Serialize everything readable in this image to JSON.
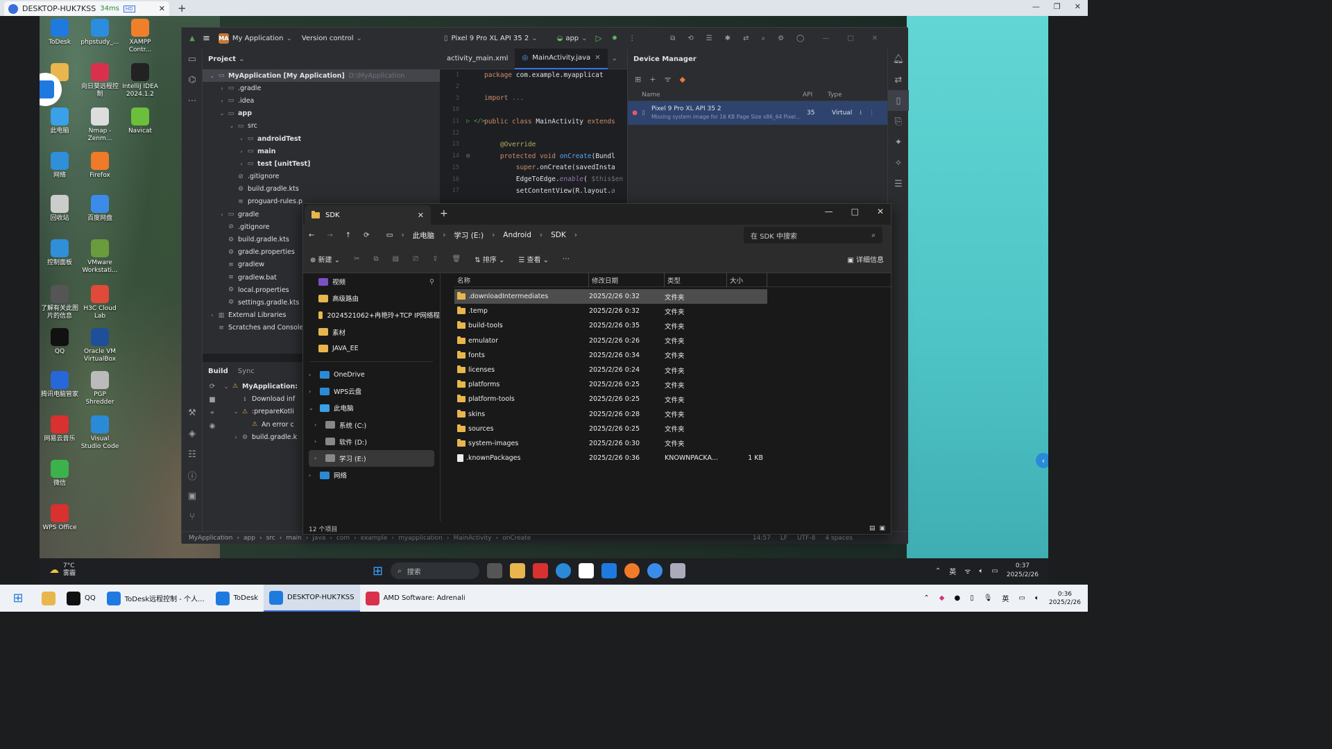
{
  "outer": {
    "tab_title": "DESKTOP-HUK7KSS",
    "latency": "34ms",
    "hd": "HD",
    "close": "✕",
    "plus": "+"
  },
  "desktop_icons": [
    {
      "label": "ToDesk",
      "color": "#1f7ae0"
    },
    {
      "label": "phpstudy_...",
      "color": "#2a8de0"
    },
    {
      "label": "XAMPP Contr...",
      "color": "#f07f2c"
    },
    {
      "label": "",
      "color": "#e8b64c"
    },
    {
      "label": "向日葵远程控制",
      "color": "#d9314b"
    },
    {
      "label": "IntelliJ IDEA 2024.1.2",
      "color": "#222"
    },
    {
      "label": "此电脑",
      "color": "#3aa0e8"
    },
    {
      "label": "Nmap - Zenm...",
      "color": "#ddd"
    },
    {
      "label": "Navicat",
      "color": "#6cbf3a"
    },
    {
      "label": "网络",
      "color": "#2f8fd8"
    },
    {
      "label": "Firefox",
      "color": "#f07a28"
    },
    {
      "label": "回收站",
      "color": "#ccc"
    },
    {
      "label": "百度网盘",
      "color": "#3b8ce8"
    },
    {
      "label": "控制面板",
      "color": "#2f8fd8"
    },
    {
      "label": "VMware Workstati...",
      "color": "#6a9b3c"
    },
    {
      "label": "了解有关此图片的信息",
      "color": "#555"
    },
    {
      "label": "H3C Cloud Lab",
      "color": "#e04a3a"
    },
    {
      "label": "QQ",
      "color": "#111"
    },
    {
      "label": "Oracle VM VirtualBox",
      "color": "#1f4f9a"
    },
    {
      "label": "腾讯电脑管家",
      "color": "#2767d9"
    },
    {
      "label": "PGP Shredder",
      "color": "#bbb"
    },
    {
      "label": "网易云音乐",
      "color": "#d93030"
    },
    {
      "label": "Visual Studio Code",
      "color": "#2b8ad8"
    },
    {
      "label": "微信",
      "color": "#3cb34a"
    },
    {
      "label": "WPS Office",
      "color": "#d93030"
    }
  ],
  "ide": {
    "project_name": "My Application",
    "vcs": "Version control",
    "device": "Pixel 9 Pro XL API 35 2",
    "run_config": "app",
    "project_pane_title": "Project",
    "tree": [
      {
        "indent": 0,
        "arrow": "v",
        "icon": "▭",
        "label": "MyApplication [My Application]",
        "dim": "D:\\MyApplication",
        "sel": true
      },
      {
        "indent": 1,
        "arrow": ">",
        "icon": "▭",
        "label": ".gradle",
        "dim": ""
      },
      {
        "indent": 1,
        "arrow": ">",
        "icon": "▭",
        "label": ".idea",
        "dim": ""
      },
      {
        "indent": 1,
        "arrow": "v",
        "icon": "▭",
        "label": "app",
        "dim": ""
      },
      {
        "indent": 2,
        "arrow": "v",
        "icon": "▭",
        "label": "src",
        "dim": ""
      },
      {
        "indent": 3,
        "arrow": ">",
        "icon": "▭",
        "label": "androidTest",
        "dim": ""
      },
      {
        "indent": 3,
        "arrow": ">",
        "icon": "▭",
        "label": "main",
        "dim": ""
      },
      {
        "indent": 3,
        "arrow": ">",
        "icon": "▭",
        "label": "test [unitTest]",
        "dim": ""
      },
      {
        "indent": 2,
        "arrow": "",
        "icon": "⊘",
        "label": ".gitignore",
        "dim": ""
      },
      {
        "indent": 2,
        "arrow": "",
        "icon": "⚙",
        "label": "build.gradle.kts",
        "dim": ""
      },
      {
        "indent": 2,
        "arrow": "",
        "icon": "≡",
        "label": "proguard-rules.p",
        "dim": ""
      },
      {
        "indent": 1,
        "arrow": ">",
        "icon": "▭",
        "label": "gradle",
        "dim": ""
      },
      {
        "indent": 1,
        "arrow": "",
        "icon": "⊘",
        "label": ".gitignore",
        "dim": ""
      },
      {
        "indent": 1,
        "arrow": "",
        "icon": "⚙",
        "label": "build.gradle.kts",
        "dim": ""
      },
      {
        "indent": 1,
        "arrow": "",
        "icon": "⚙",
        "label": "gradle.properties",
        "dim": ""
      },
      {
        "indent": 1,
        "arrow": "",
        "icon": "≡",
        "label": "gradlew",
        "dim": ""
      },
      {
        "indent": 1,
        "arrow": "",
        "icon": "≡",
        "label": "gradlew.bat",
        "dim": ""
      },
      {
        "indent": 1,
        "arrow": "",
        "icon": "⚙",
        "label": "local.properties",
        "dim": ""
      },
      {
        "indent": 1,
        "arrow": "",
        "icon": "⚙",
        "label": "settings.gradle.kts",
        "dim": ""
      },
      {
        "indent": 0,
        "arrow": ">",
        "icon": "▥",
        "label": "External Libraries",
        "dim": ""
      },
      {
        "indent": 0,
        "arrow": "",
        "icon": "≡",
        "label": "Scratches and Consoles",
        "dim": ""
      }
    ],
    "build": {
      "tab_build": "Build",
      "tab_sync": "Sync",
      "rows": [
        {
          "indent": 0,
          "arrow": "v",
          "icon": "⚠",
          "label": "MyApplication:"
        },
        {
          "indent": 1,
          "arrow": "",
          "icon": "⭳",
          "label": "Download inf"
        },
        {
          "indent": 1,
          "arrow": "v",
          "icon": "⚠",
          "label": ":prepareKotli"
        },
        {
          "indent": 2,
          "arrow": "",
          "icon": "⚠",
          "label": "An error c"
        },
        {
          "indent": 1,
          "arrow": ">",
          "icon": "⚙",
          "label": "build.gradle.k"
        }
      ]
    },
    "editor_tabs": [
      "activity_main.xml",
      "MainActivity.java"
    ],
    "code": [
      {
        "n": "1",
        "g": "",
        "html": "<span class='kw'>package</span> com.example.myapplicat"
      },
      {
        "n": "2",
        "g": "",
        "html": ""
      },
      {
        "n": "3",
        "g": "",
        "html": "<span class='kw'>import</span> <span class='cm'>...</span>"
      },
      {
        "n": "10",
        "g": "",
        "html": ""
      },
      {
        "n": "11",
        "g": "▷ </>",
        "html": "<span class='kw'>public class</span> MainActivity <span class='kw'>extends</span>"
      },
      {
        "n": "12",
        "g": "",
        "html": ""
      },
      {
        "n": "13",
        "g": "",
        "html": "&nbsp;&nbsp;&nbsp;&nbsp;<span class='an'>@Override</span>"
      },
      {
        "n": "14",
        "g": "◎",
        "html": "&nbsp;&nbsp;&nbsp;&nbsp;<span class='kw'>protected void</span> <span class='fn'>onCreate</span>(Bundl"
      },
      {
        "n": "15",
        "g": "",
        "html": "&nbsp;&nbsp;&nbsp;&nbsp;&nbsp;&nbsp;&nbsp;&nbsp;<span class='kw'>super</span>.onCreate(savedInsta"
      },
      {
        "n": "16",
        "g": "",
        "html": "&nbsp;&nbsp;&nbsp;&nbsp;&nbsp;&nbsp;&nbsp;&nbsp;EdgeToEdge.<span class='it'>enable</span>( <span class='cm'>$this$en</span>"
      },
      {
        "n": "17",
        "g": "",
        "html": "&nbsp;&nbsp;&nbsp;&nbsp;&nbsp;&nbsp;&nbsp;&nbsp;setContentView(R.layout.<span class='it'>a</span>"
      }
    ],
    "device_manager": {
      "title": "Device Manager",
      "col_name": "Name",
      "col_api": "API",
      "col_type": "Type",
      "device_name": "Pixel 9 Pro XL API 35 2",
      "device_note": "Missing system image for 16 KB Page Size x86_64 Pixel...",
      "api": "35",
      "type": "Virtual"
    },
    "status": [
      "MyApplication",
      "app",
      "src",
      "main",
      "java",
      "com",
      "example",
      "myapplication",
      "MainActivity",
      "onCreate"
    ],
    "status_right": [
      "14:57",
      "LF",
      "UTF-8",
      "4 spaces"
    ]
  },
  "explorer": {
    "tab": "SDK",
    "search_placeholder": "在 SDK 中搜索",
    "path": [
      "此电脑",
      "学习 (E:)",
      "Android",
      "SDK"
    ],
    "cmd": {
      "new": "新建",
      "sort": "排序",
      "view": "查看",
      "details": "详细信息"
    },
    "sidebar": [
      {
        "arrow": "",
        "label": "视频",
        "icon": "#7b4fc8",
        "pin": "📌"
      },
      {
        "arrow": "",
        "label": "高级路由",
        "icon": "#e8b64c"
      },
      {
        "arrow": "",
        "label": "2024521062+冉艳玲+TCP IP网络程",
        "icon": "#e8b64c"
      },
      {
        "arrow": "",
        "label": "素材",
        "icon": "#e8b64c"
      },
      {
        "arrow": "",
        "label": "JAVA_EE",
        "icon": "#e8b64c"
      },
      {
        "arrow": ">",
        "label": "OneDrive",
        "icon": "#2b8ad8"
      },
      {
        "arrow": ">",
        "label": "WPS云盘",
        "icon": "#2b8ad8"
      },
      {
        "arrow": "v",
        "label": "此电脑",
        "icon": "#3aa0e8"
      },
      {
        "arrow": ">",
        "label": "系统 (C:)",
        "icon": "#888",
        "sub": true
      },
      {
        "arrow": ">",
        "label": "软件 (D:)",
        "icon": "#888",
        "sub": true
      },
      {
        "arrow": ">",
        "label": "学习 (E:)",
        "icon": "#888",
        "sub": true,
        "sel": true
      },
      {
        "arrow": ">",
        "label": "网络",
        "icon": "#2b8ad8"
      }
    ],
    "columns": {
      "name": "名称",
      "date": "修改日期",
      "type": "类型",
      "size": "大小"
    },
    "files": [
      {
        "name": ".downloadIntermediates",
        "date": "2025/2/26 0:32",
        "type": "文件夹",
        "size": "",
        "folder": true
      },
      {
        "name": ".temp",
        "date": "2025/2/26 0:32",
        "type": "文件夹",
        "size": "",
        "folder": true
      },
      {
        "name": "build-tools",
        "date": "2025/2/26 0:35",
        "type": "文件夹",
        "size": "",
        "folder": true
      },
      {
        "name": "emulator",
        "date": "2025/2/26 0:26",
        "type": "文件夹",
        "size": "",
        "folder": true
      },
      {
        "name": "fonts",
        "date": "2025/2/26 0:34",
        "type": "文件夹",
        "size": "",
        "folder": true
      },
      {
        "name": "licenses",
        "date": "2025/2/26 0:24",
        "type": "文件夹",
        "size": "",
        "folder": true
      },
      {
        "name": "platforms",
        "date": "2025/2/26 0:25",
        "type": "文件夹",
        "size": "",
        "folder": true
      },
      {
        "name": "platform-tools",
        "date": "2025/2/26 0:25",
        "type": "文件夹",
        "size": "",
        "folder": true
      },
      {
        "name": "skins",
        "date": "2025/2/26 0:28",
        "type": "文件夹",
        "size": "",
        "folder": true
      },
      {
        "name": "sources",
        "date": "2025/2/26 0:25",
        "type": "文件夹",
        "size": "",
        "folder": true
      },
      {
        "name": "system-images",
        "date": "2025/2/26 0:30",
        "type": "文件夹",
        "size": "",
        "folder": true
      },
      {
        "name": ".knownPackages",
        "date": "2025/2/26 0:36",
        "type": "KNOWNPACKA...",
        "size": "1 KB",
        "folder": false
      }
    ],
    "status": "12 个项目"
  },
  "remote_taskbar": {
    "temp": "7°C",
    "weather": "雾霾",
    "search": "搜索",
    "lang": "英",
    "time": "0:37",
    "date": "2025/2/26"
  },
  "host_taskbar": {
    "items": [
      {
        "label": "",
        "color": "#e8b64c"
      },
      {
        "label": "QQ",
        "color": "#111"
      },
      {
        "label": "ToDesk远程控制 - 个人...",
        "color": "#1f7ae0"
      },
      {
        "label": "ToDesk",
        "color": "#1f7ae0"
      },
      {
        "label": "DESKTOP-HUK7KSS",
        "color": "#1f7ae0",
        "active": true
      },
      {
        "label": "AMD Software: Adrenali",
        "color": "#d9314b"
      }
    ],
    "lang": "英",
    "time": "0:36",
    "date": "2025/2/26"
  }
}
